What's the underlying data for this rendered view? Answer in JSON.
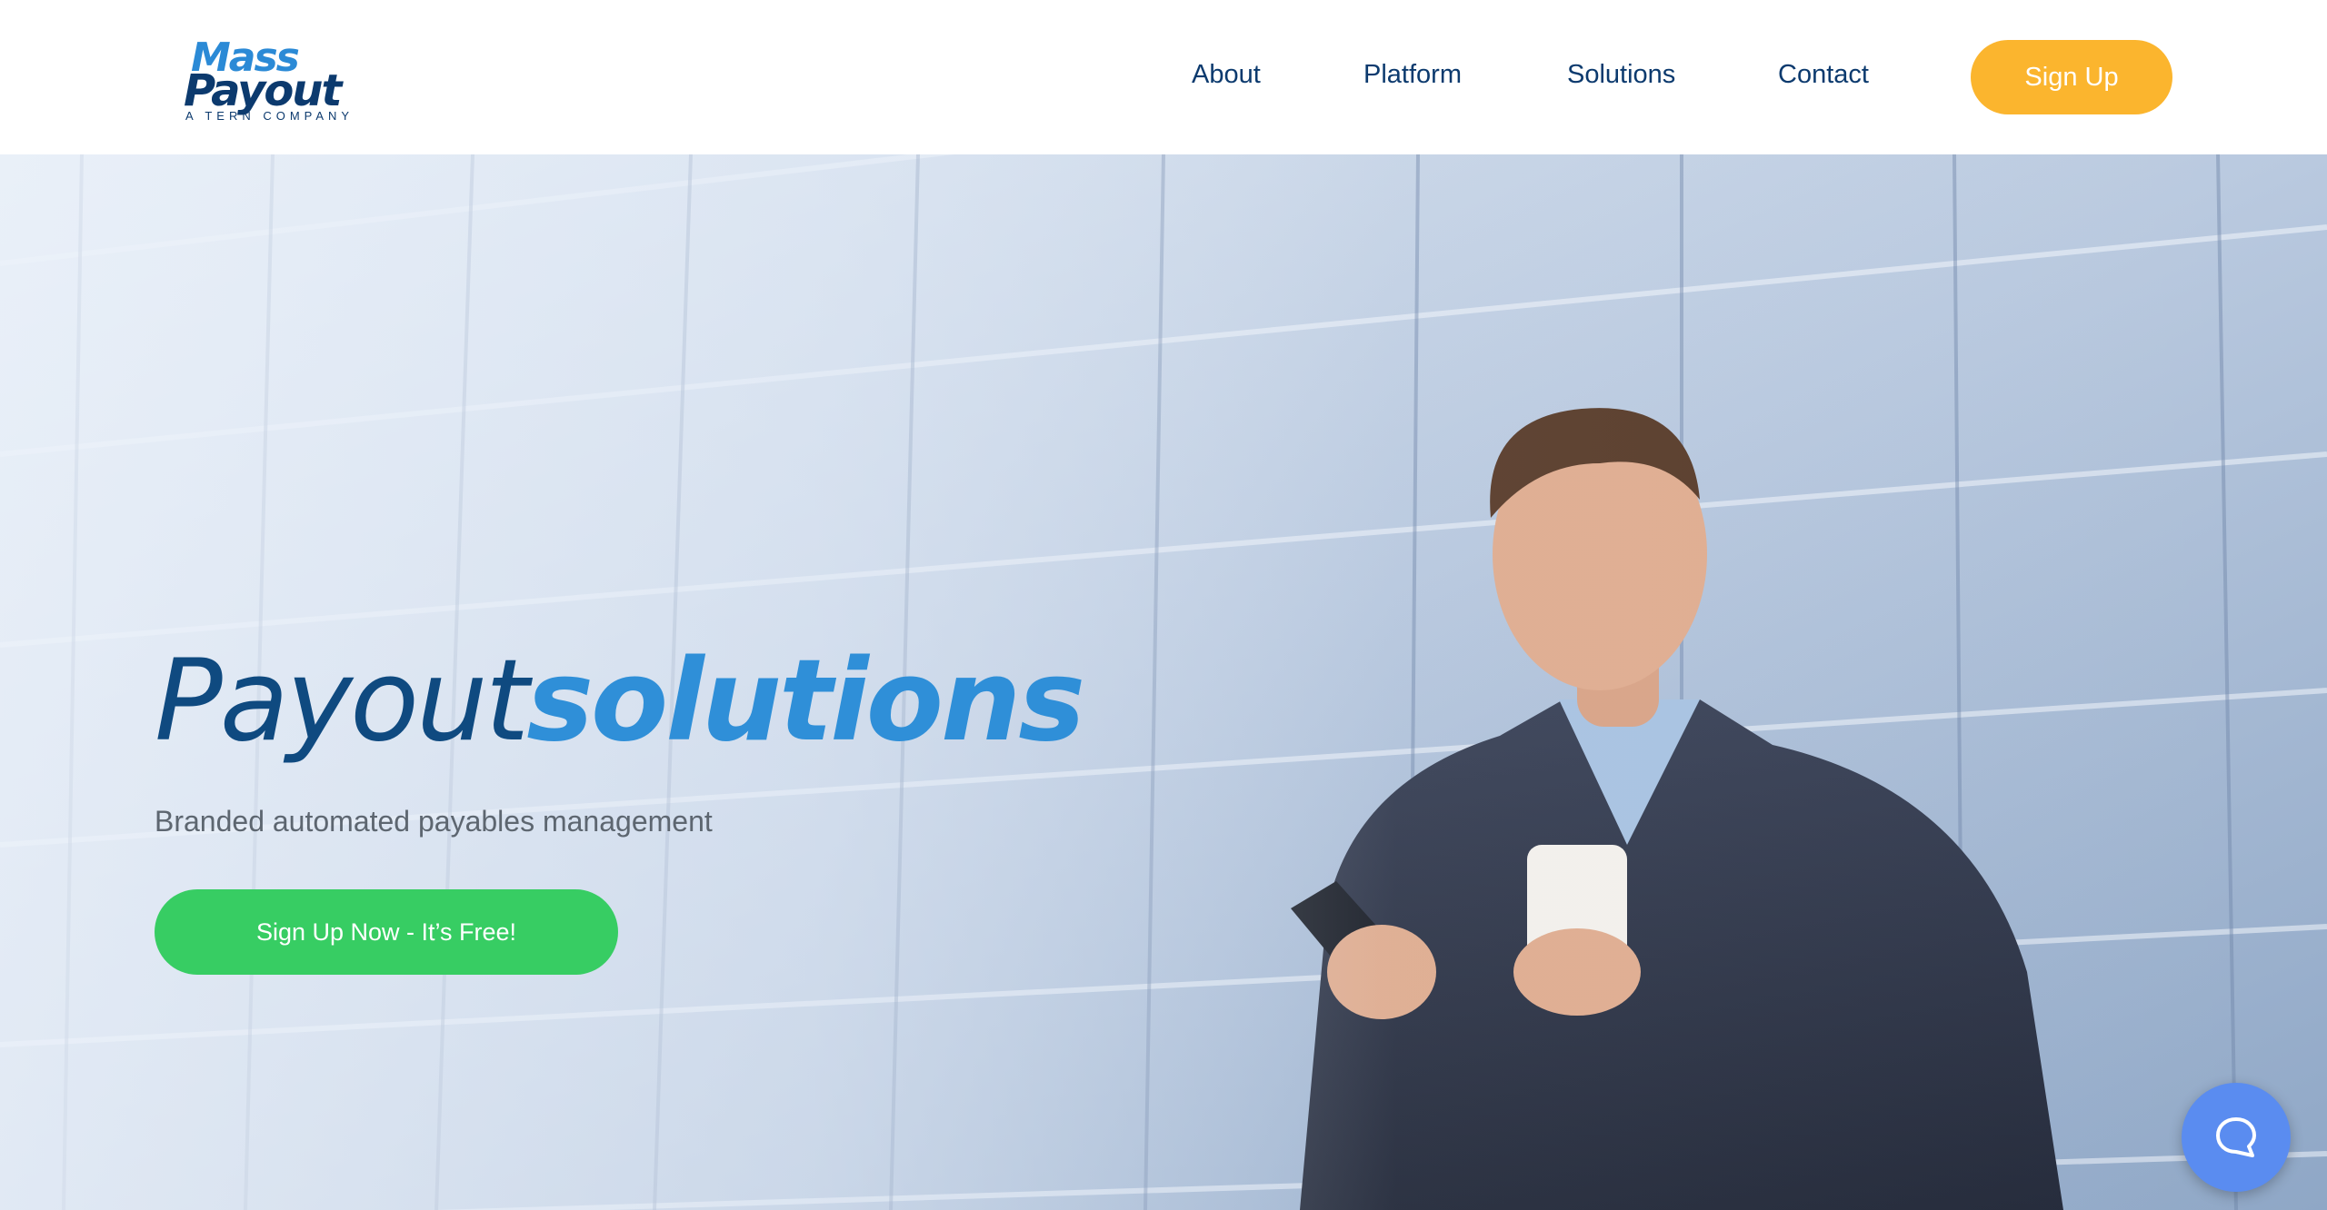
{
  "logo": {
    "line1": "Mass",
    "line2": "Payout",
    "tagline": "A TERN COMPANY"
  },
  "nav": {
    "items": [
      {
        "label": "About"
      },
      {
        "label": "Platform"
      },
      {
        "label": "Solutions"
      },
      {
        "label": "Contact"
      }
    ],
    "signup_label": "Sign Up"
  },
  "hero": {
    "title_light": "Payout",
    "title_bold": "solutions",
    "subtitle": "Branded automated payables management",
    "cta_label": "Sign Up Now - It’s Free!"
  },
  "chat": {
    "icon": "chat-bubble-icon"
  },
  "colors": {
    "brand_navy": "#0c3a6e",
    "brand_blue": "#2b8ad6",
    "signup_orange": "#fbb52e",
    "cta_green": "#37cd63",
    "chat_blue": "#5a8cf0"
  }
}
